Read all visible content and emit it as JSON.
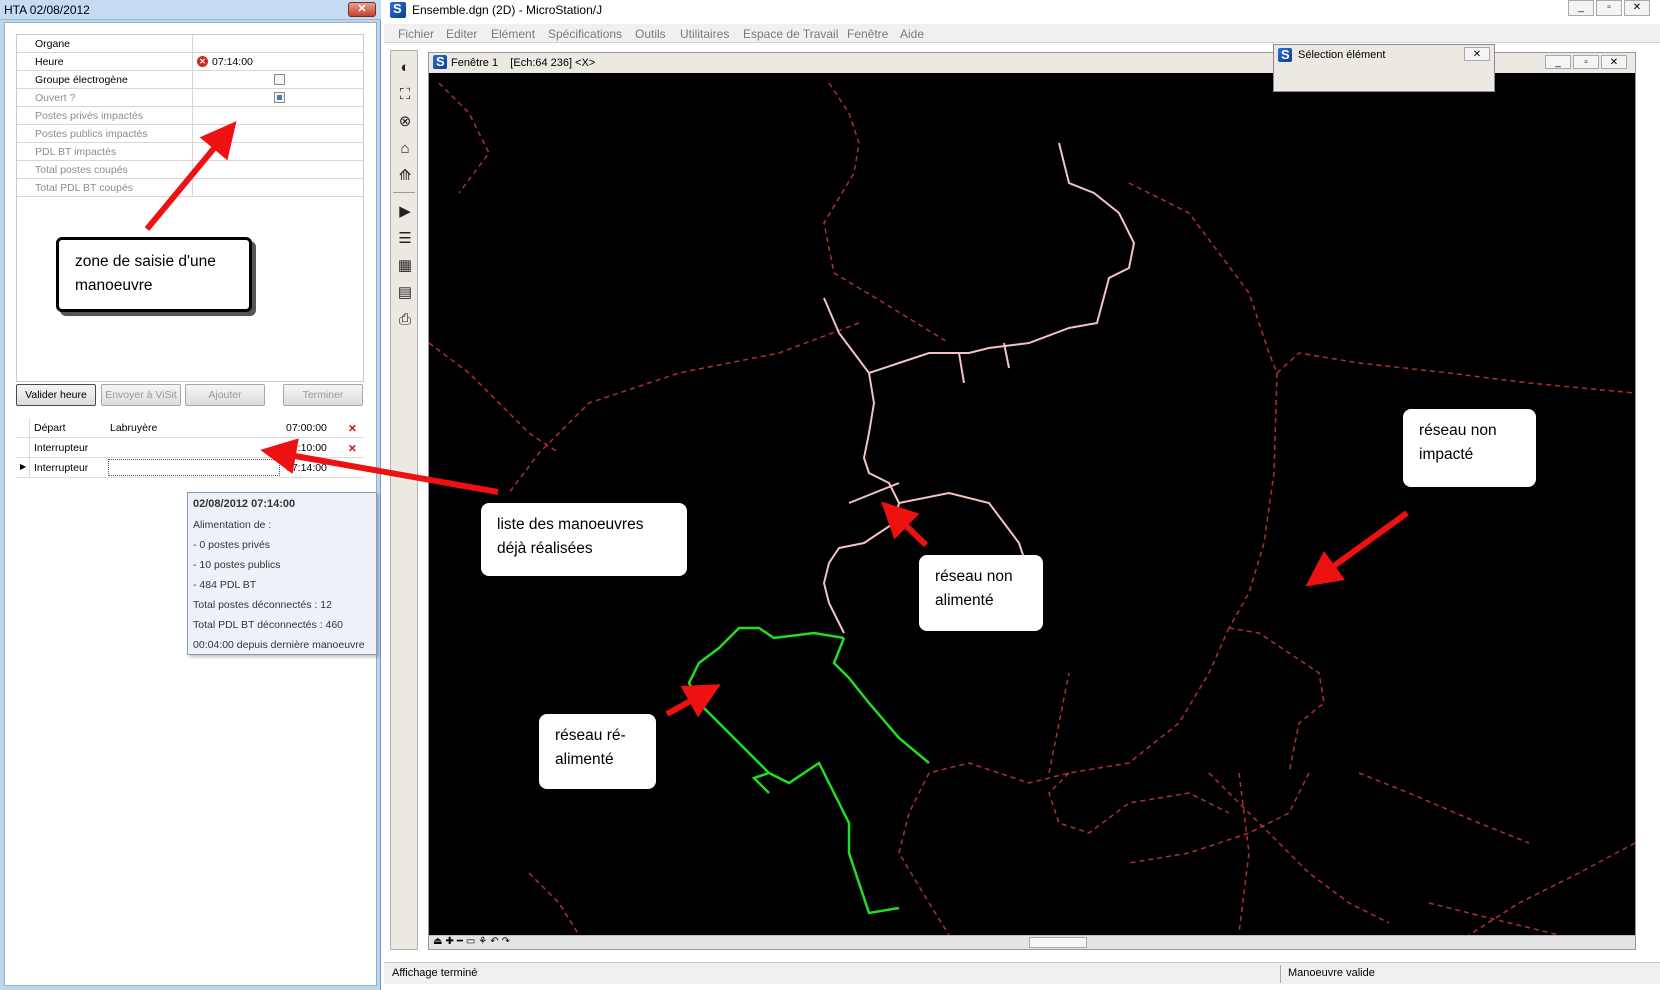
{
  "left_window": {
    "title": "HTA 02/08/2012",
    "close": "✕",
    "form": {
      "rows": [
        {
          "label": "Organe",
          "value": ""
        },
        {
          "label": "Heure",
          "value": "07:14:00"
        },
        {
          "label": "Groupe électrogène"
        },
        {
          "label": "Ouvert ?"
        },
        {
          "label": "Postes privés impactés"
        },
        {
          "label": "Postes publics impactés"
        },
        {
          "label": "PDL BT impactés"
        },
        {
          "label": "Total postes coupés"
        },
        {
          "label": "Total PDL BT coupés"
        }
      ]
    },
    "buttons": {
      "validate": "Valider heure",
      "send": "Envoyer à ViSit",
      "add": "Ajouter",
      "finish": "Terminer"
    },
    "maneuvers": [
      {
        "type": "Départ",
        "name": "Labruyère",
        "time": "07:00:00"
      },
      {
        "type": "Interrupteur",
        "name": "",
        "time": "07:10:00"
      },
      {
        "type": "Interrupteur",
        "name": "",
        "time": "07:14:00"
      }
    ],
    "tooltip": {
      "title": "02/08/2012 07:14:00",
      "lines": [
        "Alimentation de :",
        "- 0 postes privés",
        "- 10 postes publics",
        "- 484 PDL BT",
        "Total postes déconnectés : 12",
        "Total PDL BT déconnectés : 460",
        "00:04:00 depuis dernière manoeuvre"
      ]
    }
  },
  "callouts": {
    "entry_zone": "zone de saisie d'une manoeuvre",
    "done_list": "liste des manoeuvres déjà réalisées",
    "not_supplied": "réseau non alimenté",
    "not_impacted": "réseau non impacté",
    "resupplied": "réseau ré-alimenté"
  },
  "app": {
    "title": "Ensemble.dgn (2D) - MicroStation/J",
    "menu": [
      "Fichier",
      "Editer",
      "Elément",
      "Spécifications",
      "Outils",
      "Utilitaires",
      "Espace de Travail",
      "Fenêtre",
      "Aide"
    ],
    "view_title": "Fenêtre 1    [Ech:64 236] <X>",
    "selection_dialog_title": "Sélection élément",
    "status_left": "Affichage terminé",
    "status_right": "Manoeuvre valide"
  },
  "colors": {
    "network_not_impacted": "#b03030",
    "network_not_supplied": "#f4c2c2",
    "network_resupplied": "#22dd22",
    "arrow": "#ee1111"
  }
}
